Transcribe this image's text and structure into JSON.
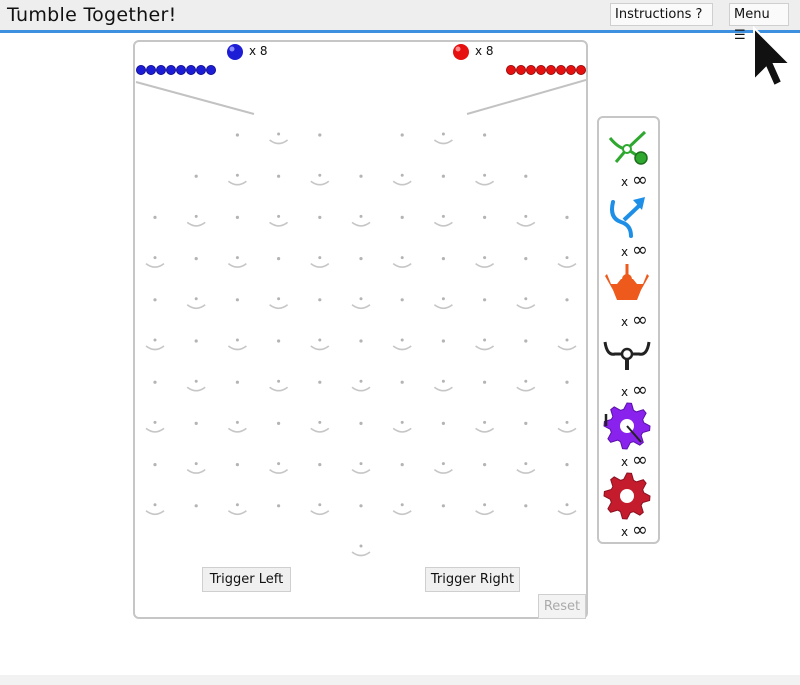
{
  "header": {
    "title": "Tumble Together!",
    "instructions_label": "Instructions ?",
    "menu_label": "Menu ☰"
  },
  "board": {
    "blue_ball_count": "x 8",
    "red_ball_count": "x 8",
    "trigger_left_label": "Trigger Left",
    "trigger_right_label": "Trigger Right",
    "reset_label": "Reset"
  },
  "parts": [
    {
      "name": "ramp",
      "quantity_prefix": "x",
      "quantity": "∞",
      "color": "#2ea82e"
    },
    {
      "name": "crossover",
      "quantity_prefix": "x",
      "quantity": "∞",
      "color": "#1e8fe6"
    },
    {
      "name": "interceptor",
      "quantity_prefix": "x",
      "quantity": "∞",
      "color": "#ee5a1c"
    },
    {
      "name": "bit",
      "quantity_prefix": "x",
      "quantity": "∞",
      "color": "#222222"
    },
    {
      "name": "gear-bit",
      "quantity_prefix": "x",
      "quantity": "∞",
      "color": "#8a22ee"
    },
    {
      "name": "gear",
      "quantity_prefix": "x",
      "quantity": "∞",
      "color": "#c41c2c"
    }
  ],
  "colors": {
    "accent": "#3d8fe0",
    "blue_ball": "#1d1dd6",
    "red_ball": "#e61010",
    "board_border": "#c6c6c6"
  }
}
